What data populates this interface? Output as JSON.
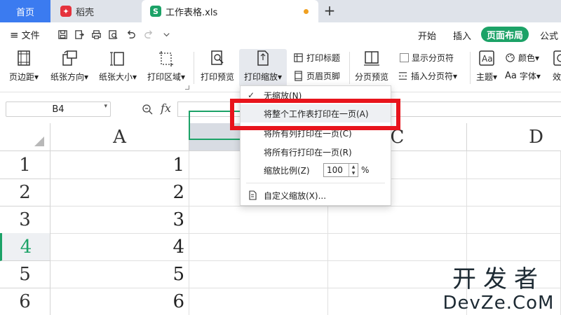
{
  "tabs": {
    "home": "首页",
    "daoke": "稻壳",
    "document": "工作表格.xls",
    "add": "+"
  },
  "menubar": {
    "file": "文件",
    "tabs": [
      "开始",
      "插入",
      "页面布局",
      "公式"
    ],
    "active_tab": "页面布局"
  },
  "ribbon": {
    "margins": "页边距",
    "orientation": "纸张方向",
    "paper_size": "纸张大小",
    "print_area": "打印区域",
    "print_preview": "打印预览",
    "print_scale": "打印缩放",
    "print_titles": "打印标题",
    "header_footer": "页眉页脚",
    "page_break_preview": "分页预览",
    "show_page_breaks": "显示分页符",
    "insert_page_break": "插入分页符",
    "theme": "主题",
    "colors": "颜色",
    "fonts": "字体",
    "effects": "效果"
  },
  "formula_bar": {
    "name_box": "B4",
    "fx": "fx"
  },
  "grid": {
    "columns": [
      "A",
      "C",
      "D"
    ],
    "rows": [
      "1",
      "2",
      "3",
      "4",
      "5",
      "6"
    ],
    "values_a": [
      "1",
      "2",
      "3",
      "4",
      "5",
      "6"
    ]
  },
  "scale_menu": {
    "no_scale": "无缩放(N)",
    "fit_sheet": "将整个工作表打印在一页(A)",
    "fit_columns": "将所有列打印在一页(C)",
    "fit_rows": "将所有行打印在一页(R)",
    "scale_ratio": "缩放比例(Z)",
    "scale_value": "100",
    "scale_unit": "%",
    "custom": "自定义缩放(X)..."
  },
  "watermark": {
    "top": "开发者",
    "bottom": "DevZe.CoM"
  },
  "colors": {
    "accent": "#1ca267",
    "home_tab": "#3b7bf0",
    "highlight": "#e8141c"
  }
}
